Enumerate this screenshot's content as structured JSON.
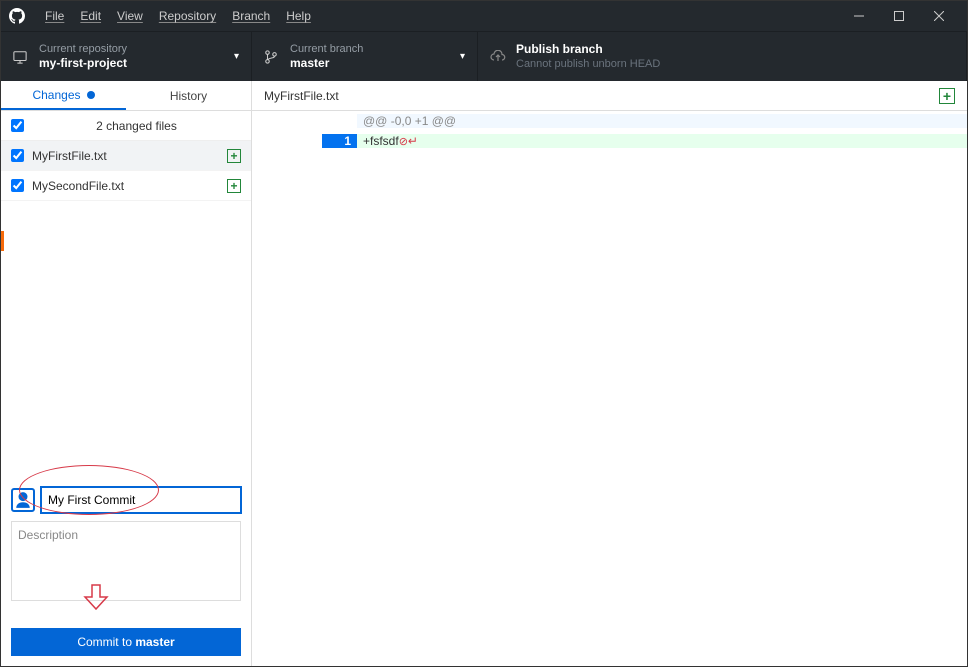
{
  "menu": {
    "file": "File",
    "edit": "Edit",
    "view": "View",
    "repository": "Repository",
    "branch": "Branch",
    "help": "Help"
  },
  "toolbar": {
    "repo": {
      "label": "Current repository",
      "value": "my-first-project"
    },
    "branch": {
      "label": "Current branch",
      "value": "master"
    },
    "publish": {
      "label": "Publish branch",
      "sub": "Cannot publish unborn HEAD"
    }
  },
  "tabs": {
    "changes": "Changes",
    "history": "History"
  },
  "changes": {
    "count_text": "2 changed files",
    "files": [
      {
        "name": "MyFirstFile.txt",
        "selected": true
      },
      {
        "name": "MySecondFile.txt",
        "selected": false
      }
    ]
  },
  "commit": {
    "summary_value": "My First Commit",
    "description_placeholder": "Description",
    "button_prefix": "Commit to ",
    "button_branch": "master"
  },
  "diff": {
    "filename": "MyFirstFile.txt",
    "hunk_header": "@@ -0,0 +1 @@",
    "lines": [
      {
        "new_no": "1",
        "prefix": "+",
        "text": "fsfsdf"
      }
    ]
  }
}
